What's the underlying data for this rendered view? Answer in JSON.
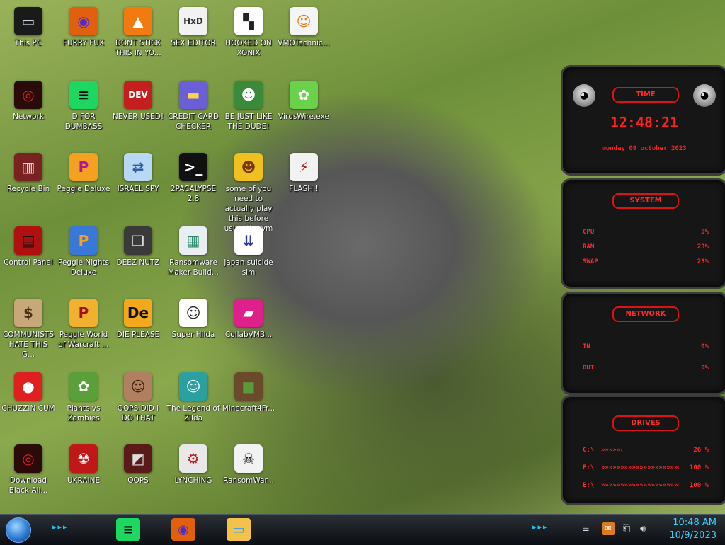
{
  "desktop": {
    "icons": [
      {
        "label": "This PC",
        "glyph": "▭",
        "bg": "#1a1a1a",
        "fg": "#cfd8e0",
        "icon": "computer-icon"
      },
      {
        "label": "FURRY FUX",
        "glyph": "◉",
        "bg": "#e0600e",
        "fg": "#4a2bd6",
        "icon": "browser-icon"
      },
      {
        "label": "DONT STICK THIS IN YO...",
        "glyph": "▲",
        "bg": "#f27a10",
        "fg": "#fff",
        "icon": "media-cone-icon"
      },
      {
        "label": "SEX EDITOR",
        "glyph": "HxD",
        "bg": "#f2f2f2",
        "fg": "#333",
        "icon": "hex-editor-icon"
      },
      {
        "label": "HOOKED ON XONIX",
        "glyph": "▚",
        "bg": "#ffffff",
        "fg": "#222",
        "icon": "game-grid-icon"
      },
      {
        "label": "VMOTechnic...",
        "glyph": "☺",
        "bg": "#f5f5f5",
        "fg": "#e08020",
        "icon": "person-icon"
      },
      {
        "label": "Network",
        "glyph": "◎",
        "bg": "#2b0a0a",
        "fg": "#e02020",
        "icon": "network-icon"
      },
      {
        "label": "D FOR DUMBASS",
        "glyph": "≡",
        "bg": "#1ed760",
        "fg": "#000",
        "icon": "chat-app-icon"
      },
      {
        "label": "NEVER USED!",
        "glyph": "DEV",
        "bg": "#c41e1e",
        "fg": "#fff",
        "icon": "dev-ide-icon"
      },
      {
        "label": "CREDIT CARD CHECKER",
        "glyph": "▬",
        "bg": "#6a5fd6",
        "fg": "#ffd24a",
        "icon": "credit-card-icon"
      },
      {
        "label": "BE JUST LIKE THE DUDE!",
        "glyph": "☻",
        "bg": "#3a8a3a",
        "fg": "#fff",
        "icon": "dude-icon"
      },
      {
        "label": "VirusWire.exe",
        "glyph": "✿",
        "bg": "#6ad24a",
        "fg": "#fff",
        "icon": "lime-icon"
      },
      {
        "label": "Recycle Bin",
        "glyph": "▥",
        "bg": "#7a2222",
        "fg": "#ddd",
        "icon": "recycle-bin-icon"
      },
      {
        "label": "Peggle Deluxe",
        "glyph": "P",
        "bg": "#f4a020",
        "fg": "#b0189a",
        "icon": "peggle-icon"
      },
      {
        "label": "ISRAEL SPY",
        "glyph": "⇄",
        "bg": "#b8d8f4",
        "fg": "#2a5aa0",
        "icon": "network-spy-icon"
      },
      {
        "label": "2PACALYPSE 2.8",
        "glyph": ">_",
        "bg": "#111",
        "fg": "#fff",
        "icon": "terminal-icon"
      },
      {
        "label": "some of you need to actually play this before using the vm",
        "glyph": "☻",
        "bg": "#f0c020",
        "fg": "#7a3a10",
        "icon": "cartoon-dog-icon"
      },
      {
        "label": "FLASH !",
        "glyph": "⚡",
        "bg": "#f2f2f2",
        "fg": "#c01818",
        "icon": "flash-icon"
      },
      {
        "label": "Control Panel",
        "glyph": "▤",
        "bg": "#b01010",
        "fg": "#111",
        "icon": "control-panel-icon"
      },
      {
        "label": "Peggle Nights Deluxe",
        "glyph": "P",
        "bg": "#3a78d8",
        "fg": "#f4a020",
        "icon": "peggle-nights-icon"
      },
      {
        "label": "DEEZ NUTZ",
        "glyph": "❏",
        "bg": "#3a3a3a",
        "fg": "#ddd",
        "icon": "windows-stack-icon"
      },
      {
        "label": "Ransomware Maker Build...",
        "glyph": "▦",
        "bg": "#e8eef2",
        "fg": "#2a8a6a",
        "icon": "builder-window-icon"
      },
      {
        "label": "japan suicide sim",
        "glyph": "⇊",
        "bg": "#ffffff",
        "fg": "#2a3aa0",
        "icon": "sim-game-icon"
      },
      {
        "label": "COMMUNISTS HATE THIS G...",
        "glyph": "$",
        "bg": "#c8a878",
        "fg": "#4a3010",
        "icon": "money-bag-icon"
      },
      {
        "label": "Peggle World of Warcraft ...",
        "glyph": "P",
        "bg": "#f0b030",
        "fg": "#a01010",
        "icon": "peggle-warcraft-icon"
      },
      {
        "label": "DIE PLEASE",
        "glyph": "De",
        "bg": "#f4a81c",
        "fg": "#111",
        "icon": "design-app-icon"
      },
      {
        "label": "Super Hilda",
        "glyph": "☺",
        "bg": "#fff",
        "fg": "#222",
        "icon": "pixel-dog-icon"
      },
      {
        "label": "CollabVMB...",
        "glyph": "▰",
        "bg": "#e0208a",
        "fg": "#fff",
        "icon": "monitor-icon"
      },
      {
        "label": "CHUZZIN CUM",
        "glyph": "●",
        "bg": "#e02020",
        "fg": "#fff",
        "icon": "chuzzle-icon"
      },
      {
        "label": "Plants vs Zombies",
        "glyph": "✿",
        "bg": "#5aa03a",
        "fg": "#fff",
        "icon": "plant-icon"
      },
      {
        "label": "OOPS DID I DO THAT",
        "glyph": "☺",
        "bg": "#b08060",
        "fg": "#3a1a0a",
        "icon": "portrait-icon"
      },
      {
        "label": "The Legend of Zilda",
        "glyph": "☺",
        "bg": "#2aa0a0",
        "fg": "#fff",
        "icon": "pixel-hero-icon"
      },
      {
        "label": "Minecraft4Fr...",
        "glyph": "■",
        "bg": "#6a4a2a",
        "fg": "#5a9a3a",
        "icon": "grass-block-icon"
      },
      {
        "label": "Download Black Ali...",
        "glyph": "◎",
        "bg": "#2b0a0a",
        "fg": "#e02020",
        "icon": "alien-download-icon"
      },
      {
        "label": "UKRAINE",
        "glyph": "☢",
        "bg": "#c01818",
        "fg": "#fff",
        "icon": "radiation-icon"
      },
      {
        "label": "OOPS",
        "glyph": "◩",
        "bg": "#5a1a1a",
        "fg": "#ddd",
        "icon": "frame-icon"
      },
      {
        "label": "LYNCHING",
        "glyph": "⚙",
        "bg": "#e8e8e8",
        "fg": "#c01818",
        "icon": "gear-flag-icon"
      },
      {
        "label": "RansomWar...",
        "glyph": "☠",
        "bg": "#f2f2f2",
        "fg": "#111",
        "icon": "skull-icon"
      }
    ]
  },
  "widget": {
    "time": {
      "title": "TIME",
      "clock": "12:48:21",
      "date": "monday 09 october 2023"
    },
    "system": {
      "title": "SYSTEM",
      "rows": [
        {
          "label": "CPU",
          "value": "5%"
        },
        {
          "label": "RAM",
          "value": "23%"
        },
        {
          "label": "SWAP",
          "value": "23%"
        }
      ]
    },
    "network": {
      "title": "NETWORK",
      "rows": [
        {
          "label": "IN",
          "value": "0%"
        },
        {
          "label": "OUT",
          "value": "0%"
        }
      ]
    },
    "drives": {
      "title": "DRIVES",
      "rows": [
        {
          "label": "C:\\",
          "value": "26 %",
          "level": 0.26
        },
        {
          "label": "F:\\",
          "value": "100 %",
          "level": 1.0
        },
        {
          "label": "E:\\",
          "value": "100 %",
          "level": 1.0
        }
      ]
    }
  },
  "taskbar": {
    "apps": [
      {
        "name": "chat-app-taskbar-button",
        "glyph": "≡",
        "bg": "#1ed760",
        "fg": "#000"
      },
      {
        "name": "browser-taskbar-button",
        "glyph": "◉",
        "bg": "#e0600e",
        "fg": "#4a2bd6"
      },
      {
        "name": "file-explorer-taskbar-button",
        "glyph": "▭",
        "bg": "#f2c24a",
        "fg": "#4aa0e0"
      }
    ],
    "clock_time": "10:48 AM",
    "clock_date": "10/9/2023"
  },
  "colors": {
    "widget_red": "#ff2a2a",
    "clock_blue": "#3fd2ff"
  }
}
